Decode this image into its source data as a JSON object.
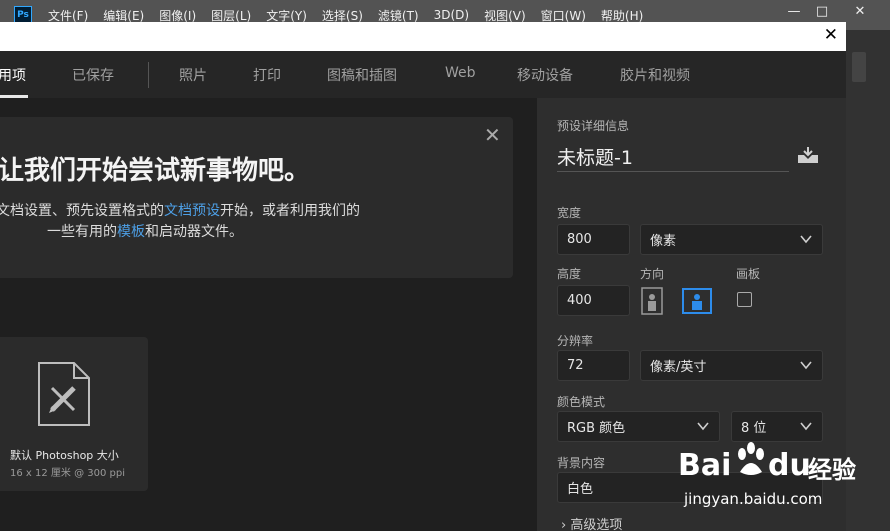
{
  "menubar": {
    "logo": "Ps",
    "items": [
      "文件(F)",
      "编辑(E)",
      "图像(I)",
      "图层(L)",
      "文字(Y)",
      "选择(S)",
      "滤镜(T)",
      "3D(D)",
      "视图(V)",
      "窗口(W)",
      "帮助(H)"
    ],
    "controls": [
      "—",
      "□",
      "✕"
    ]
  },
  "dialog": {
    "close_glyph": "✕",
    "tabs": [
      "用项",
      "已保存",
      "照片",
      "打印",
      "图稿和插图",
      "Web",
      "移动设备",
      "胶片和视频"
    ],
    "active_tab": "用项",
    "welcome": {
      "close_glyph": "✕",
      "title": "让我们开始尝试新事物吧。",
      "line1_pre": "文档设置、预先设置格式的",
      "line1_link": "文档预设",
      "line1_post": "开始，或者利用我们的",
      "line2_pre": "一些有用的",
      "line2_link": "模板",
      "line2_post": "和启动器文件。"
    },
    "preset": {
      "name": "默认 Photoshop 大小",
      "dimensions": "16 x 12 厘米 @ 300 ppi"
    },
    "details": {
      "heading": "预设详细信息",
      "doc_title": "未标题-1",
      "width_label": "宽度",
      "width_value": "800",
      "width_unit": "像素",
      "height_label": "高度",
      "height_value": "400",
      "orientation_label": "方向",
      "artboard_label": "画板",
      "resolution_label": "分辨率",
      "resolution_value": "72",
      "resolution_unit": "像素/英寸",
      "color_mode_label": "颜色模式",
      "color_mode_value": "RGB 颜色",
      "bit_depth_value": "8 位",
      "background_label": "背景内容",
      "background_value": "白色",
      "advanced_label": "高级选项",
      "advanced_glyph": "›"
    }
  },
  "watermark": {
    "brand_bai": "Bai",
    "brand_du": "du",
    "brand_cn": "经验",
    "url": "jingyan.baidu.com"
  },
  "colors": {
    "accent_link": "#4d9fe6",
    "active_orientation": "#2d8ceb",
    "menubar_bg": "#535353",
    "dialog_bg": "#1f1f1f",
    "panel_bg": "#2e2e2e"
  }
}
